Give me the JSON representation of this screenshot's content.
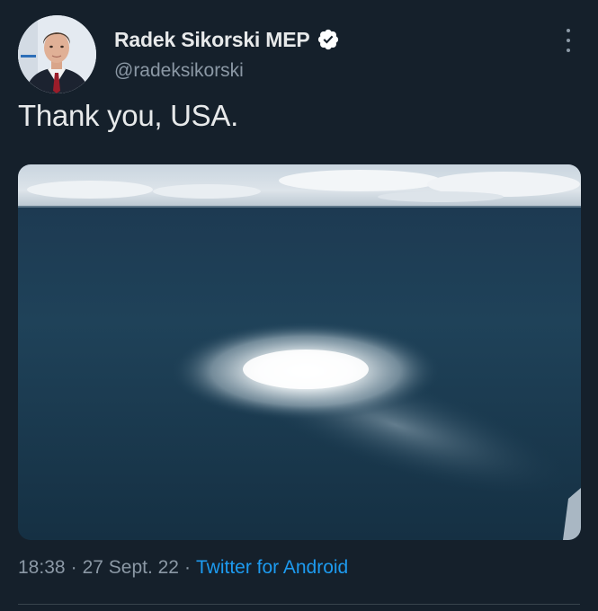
{
  "author": {
    "display_name": "Radek Sikorski MEP",
    "handle": "@radeksikorski",
    "verified": true
  },
  "tweet": {
    "text": "Thank you, USA.",
    "time": "18:38",
    "date": "27 Sept. 22",
    "source": "Twitter for Android",
    "separator": "·"
  },
  "media": {
    "icon": "aerial-sea-photo-icon"
  },
  "colors": {
    "background": "#15202b",
    "text_primary": "#e7e9ea",
    "text_secondary": "#8b98a5",
    "link": "#1d9bf0",
    "verified_badge": "#ffffff"
  }
}
